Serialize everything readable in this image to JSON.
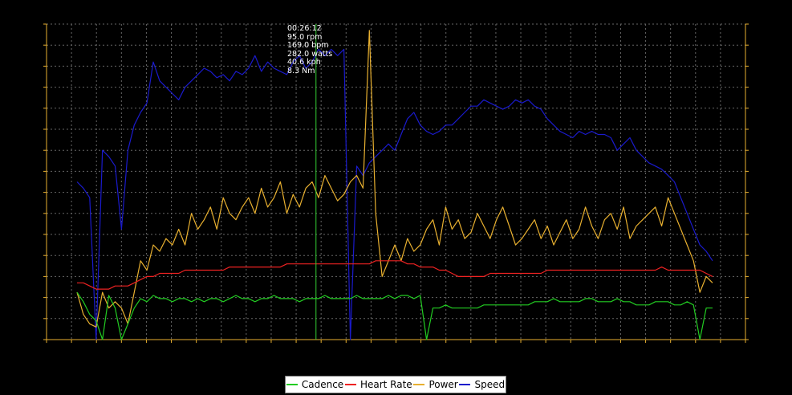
{
  "chart_data": {
    "type": "line",
    "xlabel": "",
    "ylabel": "",
    "grid": true,
    "legend_position": "bottom",
    "x": [
      0,
      0.01,
      0.02,
      0.03,
      0.04,
      0.05,
      0.06,
      0.07,
      0.08,
      0.09,
      0.1,
      0.11,
      0.12,
      0.13,
      0.14,
      0.15,
      0.16,
      0.17,
      0.18,
      0.19,
      0.2,
      0.21,
      0.22,
      0.23,
      0.24,
      0.25,
      0.26,
      0.27,
      0.28,
      0.29,
      0.3,
      0.31,
      0.32,
      0.33,
      0.34,
      0.35,
      0.36,
      0.37,
      0.38,
      0.39,
      0.4,
      0.41,
      0.42,
      0.43,
      0.44,
      0.45,
      0.46,
      0.47,
      0.48,
      0.49,
      0.5,
      0.51,
      0.52,
      0.53,
      0.54,
      0.55,
      0.56,
      0.57,
      0.58,
      0.59,
      0.6,
      0.61,
      0.62,
      0.63,
      0.64,
      0.65,
      0.66,
      0.67,
      0.68,
      0.69,
      0.7,
      0.71,
      0.72,
      0.73,
      0.74,
      0.75,
      0.76,
      0.77,
      0.78,
      0.79,
      0.8,
      0.81,
      0.82,
      0.83,
      0.84,
      0.85,
      0.86,
      0.87,
      0.88,
      0.89,
      0.9,
      0.91,
      0.92,
      0.93,
      0.94,
      0.95,
      0.96,
      0.97,
      0.98,
      0.99,
      1.0
    ],
    "series": [
      {
        "name": "Cadence",
        "color": "#22cc22",
        "values": [
          0.15,
          0.12,
          0.08,
          0.06,
          0.0,
          0.14,
          0.1,
          0.0,
          0.05,
          0.1,
          0.13,
          0.12,
          0.14,
          0.13,
          0.13,
          0.12,
          0.13,
          0.13,
          0.12,
          0.13,
          0.12,
          0.13,
          0.13,
          0.12,
          0.13,
          0.14,
          0.13,
          0.13,
          0.12,
          0.13,
          0.13,
          0.14,
          0.13,
          0.13,
          0.13,
          0.12,
          0.13,
          0.13,
          0.13,
          0.14,
          0.13,
          0.13,
          0.13,
          0.13,
          0.14,
          0.13,
          0.13,
          0.13,
          0.13,
          0.14,
          0.13,
          0.14,
          0.14,
          0.13,
          0.14,
          0.0,
          0.1,
          0.1,
          0.11,
          0.1,
          0.1,
          0.1,
          0.1,
          0.1,
          0.11,
          0.11,
          0.11,
          0.11,
          0.11,
          0.11,
          0.11,
          0.11,
          0.12,
          0.12,
          0.12,
          0.13,
          0.12,
          0.12,
          0.12,
          0.12,
          0.13,
          0.13,
          0.12,
          0.12,
          0.12,
          0.13,
          0.12,
          0.12,
          0.11,
          0.11,
          0.11,
          0.12,
          0.12,
          0.12,
          0.11,
          0.11,
          0.12,
          0.11,
          0.0,
          0.1,
          0.1
        ]
      },
      {
        "name": "Heart Rate",
        "color": "#ee2222",
        "values": [
          0.18,
          0.18,
          0.17,
          0.16,
          0.16,
          0.16,
          0.17,
          0.17,
          0.17,
          0.18,
          0.19,
          0.2,
          0.2,
          0.21,
          0.21,
          0.21,
          0.21,
          0.22,
          0.22,
          0.22,
          0.22,
          0.22,
          0.22,
          0.22,
          0.23,
          0.23,
          0.23,
          0.23,
          0.23,
          0.23,
          0.23,
          0.23,
          0.23,
          0.24,
          0.24,
          0.24,
          0.24,
          0.24,
          0.24,
          0.24,
          0.24,
          0.24,
          0.24,
          0.24,
          0.24,
          0.24,
          0.24,
          0.25,
          0.25,
          0.25,
          0.25,
          0.25,
          0.24,
          0.24,
          0.23,
          0.23,
          0.23,
          0.22,
          0.22,
          0.21,
          0.2,
          0.2,
          0.2,
          0.2,
          0.2,
          0.21,
          0.21,
          0.21,
          0.21,
          0.21,
          0.21,
          0.21,
          0.21,
          0.21,
          0.22,
          0.22,
          0.22,
          0.22,
          0.22,
          0.22,
          0.22,
          0.22,
          0.22,
          0.22,
          0.22,
          0.22,
          0.22,
          0.22,
          0.22,
          0.22,
          0.22,
          0.22,
          0.23,
          0.22,
          0.22,
          0.22,
          0.22,
          0.22,
          0.22,
          0.21,
          0.2
        ]
      },
      {
        "name": "Power",
        "color": "#e8b030",
        "values": [
          0.15,
          0.08,
          0.05,
          0.04,
          0.15,
          0.1,
          0.12,
          0.1,
          0.05,
          0.15,
          0.25,
          0.22,
          0.3,
          0.28,
          0.32,
          0.3,
          0.35,
          0.3,
          0.4,
          0.35,
          0.38,
          0.42,
          0.35,
          0.45,
          0.4,
          0.38,
          0.42,
          0.45,
          0.4,
          0.48,
          0.42,
          0.45,
          0.5,
          0.4,
          0.46,
          0.42,
          0.48,
          0.5,
          0.45,
          0.52,
          0.48,
          0.44,
          0.46,
          0.5,
          0.52,
          0.48,
          0.98,
          0.4,
          0.2,
          0.25,
          0.3,
          0.25,
          0.32,
          0.28,
          0.3,
          0.35,
          0.38,
          0.3,
          0.42,
          0.35,
          0.38,
          0.32,
          0.34,
          0.4,
          0.36,
          0.32,
          0.38,
          0.42,
          0.36,
          0.3,
          0.32,
          0.35,
          0.38,
          0.32,
          0.36,
          0.3,
          0.34,
          0.38,
          0.32,
          0.35,
          0.42,
          0.36,
          0.32,
          0.38,
          0.4,
          0.35,
          0.42,
          0.32,
          0.36,
          0.38,
          0.4,
          0.42,
          0.36,
          0.45,
          0.4,
          0.35,
          0.3,
          0.25,
          0.15,
          0.2,
          0.18
        ]
      },
      {
        "name": "Speed",
        "color": "#1a1acc",
        "values": [
          0.5,
          0.48,
          0.45,
          0.0,
          0.6,
          0.58,
          0.55,
          0.35,
          0.6,
          0.68,
          0.72,
          0.75,
          0.88,
          0.82,
          0.8,
          0.78,
          0.76,
          0.8,
          0.82,
          0.84,
          0.86,
          0.85,
          0.83,
          0.84,
          0.82,
          0.85,
          0.84,
          0.86,
          0.9,
          0.85,
          0.88,
          0.86,
          0.85,
          0.84,
          0.88,
          0.9,
          0.86,
          0.88,
          0.92,
          0.9,
          0.92,
          0.9,
          0.92,
          0.0,
          0.55,
          0.52,
          0.56,
          0.58,
          0.6,
          0.62,
          0.6,
          0.65,
          0.7,
          0.72,
          0.68,
          0.66,
          0.65,
          0.66,
          0.68,
          0.68,
          0.7,
          0.72,
          0.74,
          0.74,
          0.76,
          0.75,
          0.74,
          0.73,
          0.74,
          0.76,
          0.75,
          0.76,
          0.74,
          0.73,
          0.7,
          0.68,
          0.66,
          0.65,
          0.64,
          0.66,
          0.65,
          0.66,
          0.65,
          0.65,
          0.64,
          0.6,
          0.62,
          0.64,
          0.6,
          0.58,
          0.56,
          0.55,
          0.54,
          0.52,
          0.5,
          0.45,
          0.4,
          0.35,
          0.3,
          0.28,
          0.25
        ]
      }
    ],
    "cursor": {
      "x": 0.376
    },
    "readout": [
      "00:26:12",
      "95.0 rpm",
      "169.0 bpm",
      "282.0 watts",
      "40.6 kph",
      "8.3 Nm"
    ],
    "legend": [
      "Cadence",
      "Heart Rate",
      "Power",
      "Speed"
    ]
  },
  "colors": {
    "background": "#000000",
    "axis": "#e8b030",
    "grid": "#666666",
    "cursor": "#33cc33"
  }
}
